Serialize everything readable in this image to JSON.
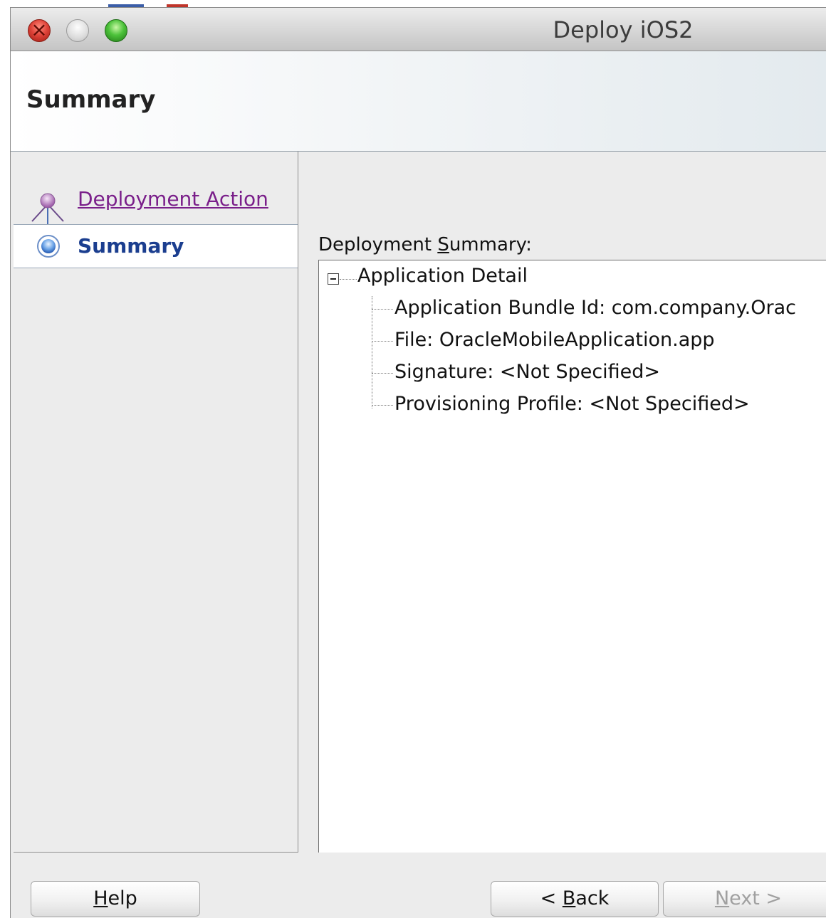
{
  "window": {
    "title": "Deploy iOS2"
  },
  "banner": {
    "title": "Summary"
  },
  "nav": {
    "items": [
      {
        "label": "Deployment Action",
        "state": "visited"
      },
      {
        "label": "Summary",
        "state": "current"
      }
    ]
  },
  "content": {
    "summary_label_prefix": "Deployment ",
    "summary_label_mnemonic": "S",
    "summary_label_suffix": "ummary:",
    "tree": {
      "root": "Application Detail",
      "children": [
        "Application Bundle Id:  com.company.Orac",
        "File:  OracleMobileApplication.app",
        "Signature:  <Not Specified>",
        "Provisioning Profile:  <Not Specified>"
      ]
    }
  },
  "footer": {
    "help": {
      "mnemonic": "H",
      "rest": "elp"
    },
    "back": {
      "prefix": "< ",
      "mnemonic": "B",
      "rest": "ack"
    },
    "next": {
      "mnemonic": "N",
      "rest": "ext >",
      "enabled": false
    }
  },
  "icons": {
    "close": "close-icon",
    "minimize": "minimize-icon",
    "zoom": "zoom-icon",
    "step_visited": "step-visited-icon",
    "step_current": "step-current-icon",
    "collapse": "collapse-icon"
  },
  "colors": {
    "nav_link": "#7a1f8a",
    "nav_current": "#1b3e8f",
    "window_bg": "#ececec"
  }
}
